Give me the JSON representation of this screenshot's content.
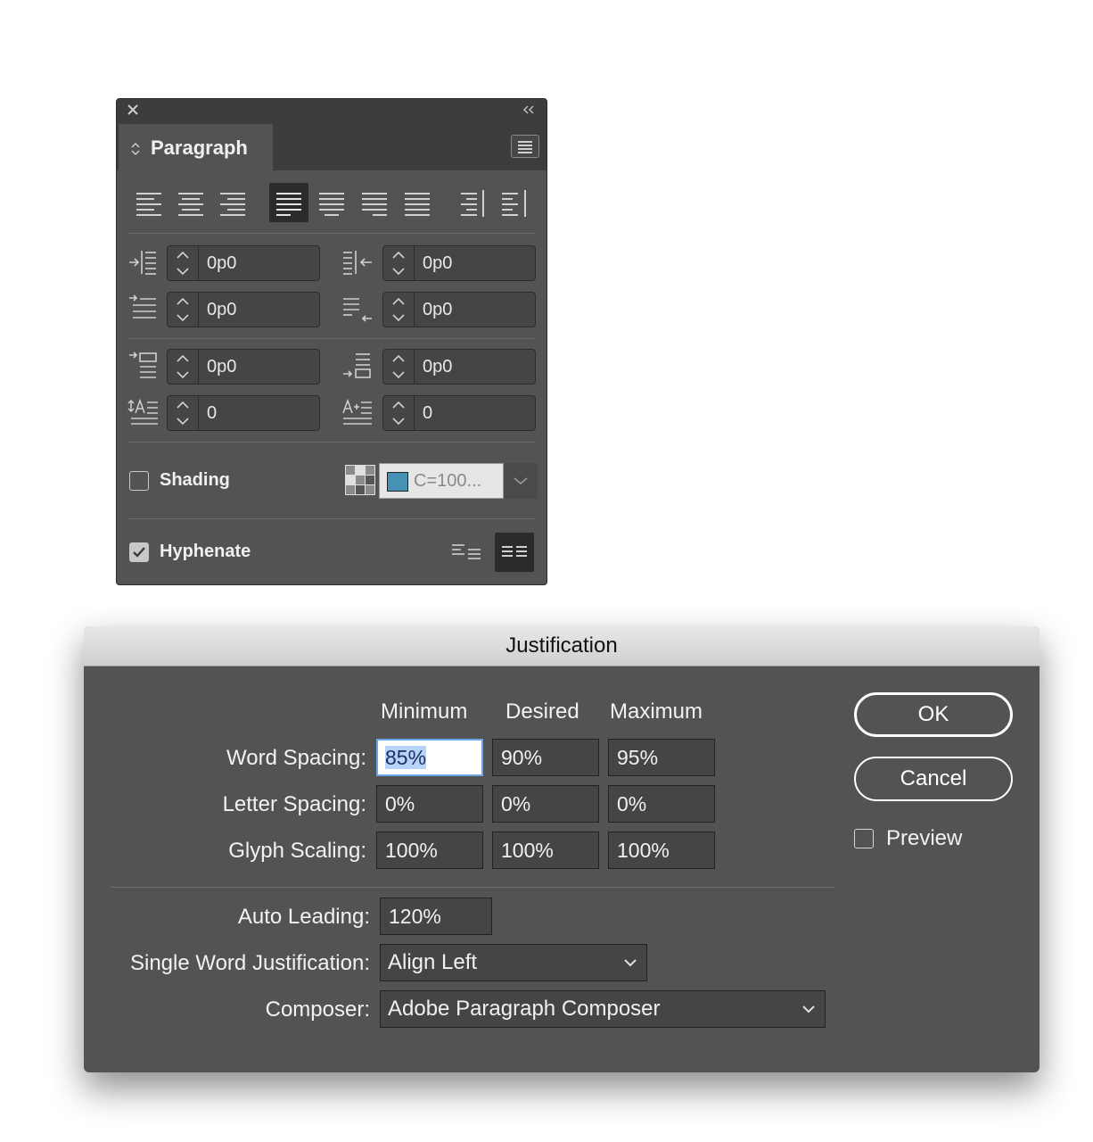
{
  "paragraph_panel": {
    "tab_title": "Paragraph",
    "icons": {
      "close": "close-icon",
      "collapse": "double-chevron-left-icon",
      "menu": "panel-menu-icon",
      "updown": "updown-icon"
    },
    "alignment_buttons": [
      {
        "name": "align-left",
        "active": false
      },
      {
        "name": "align-center",
        "active": false
      },
      {
        "name": "align-right",
        "active": false
      },
      {
        "name": "justify-left",
        "active": true
      },
      {
        "name": "justify-center",
        "active": false
      },
      {
        "name": "justify-right",
        "active": false
      },
      {
        "name": "justify-all",
        "active": false
      },
      {
        "name": "align-towards-spine",
        "active": false
      },
      {
        "name": "align-away-from-spine",
        "active": false
      }
    ],
    "fields": {
      "left_indent": "0p0",
      "right_indent": "0p0",
      "first_line_indent": "0p0",
      "last_line_right_indent": "0p0",
      "space_before": "0p0",
      "space_after": "0p0",
      "drop_cap_lines": "0",
      "drop_cap_characters": "0"
    },
    "shading": {
      "label": "Shading",
      "checked": false,
      "color_text": "C=100...",
      "color": "#4592b5"
    },
    "hyphenate": {
      "label": "Hyphenate",
      "checked": true
    }
  },
  "justification_dialog": {
    "title": "Justification",
    "columns": [
      "Minimum",
      "Desired",
      "Maximum"
    ],
    "rows": [
      {
        "label": "Word Spacing:",
        "values": [
          "85%",
          "90%",
          "95%"
        ]
      },
      {
        "label": "Letter Spacing:",
        "values": [
          "0%",
          "0%",
          "0%"
        ]
      },
      {
        "label": "Glyph Scaling:",
        "values": [
          "100%",
          "100%",
          "100%"
        ]
      }
    ],
    "auto_leading": {
      "label": "Auto Leading:",
      "value": "120%"
    },
    "single_word": {
      "label": "Single Word Justification:",
      "value": "Align Left"
    },
    "composer": {
      "label": "Composer:",
      "value": "Adobe Paragraph Composer"
    },
    "buttons": {
      "ok": "OK",
      "cancel": "Cancel"
    },
    "preview": {
      "label": "Preview",
      "checked": false
    }
  }
}
